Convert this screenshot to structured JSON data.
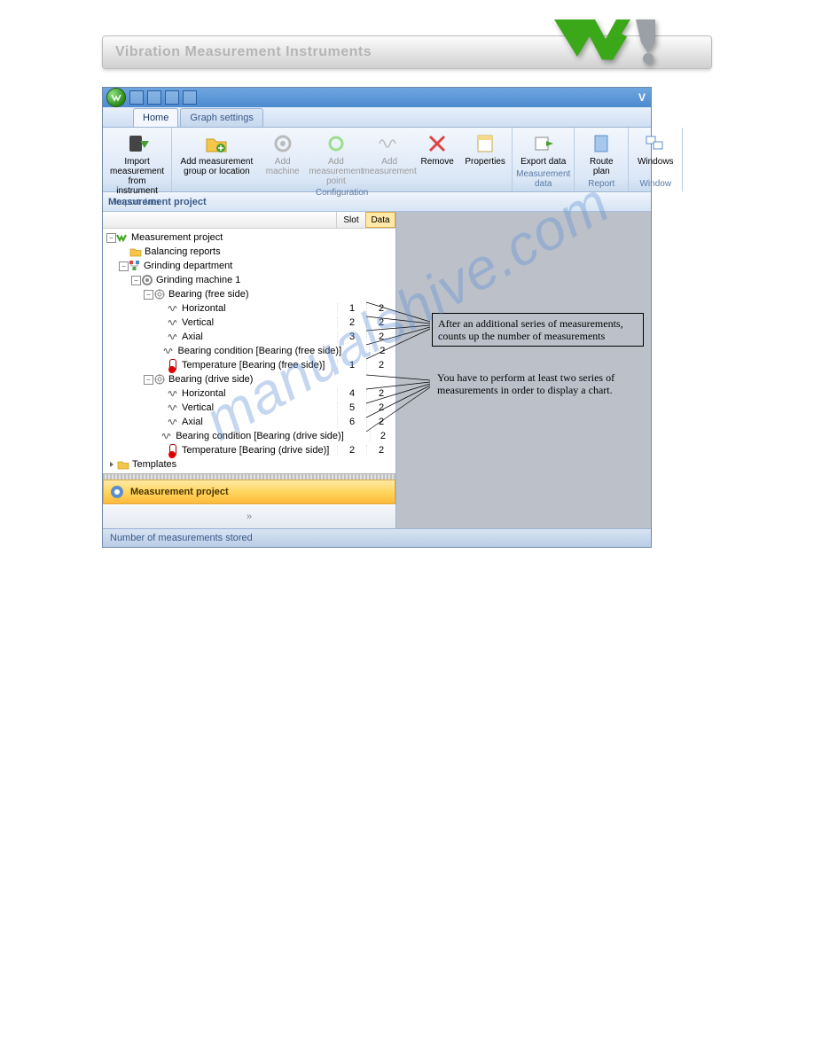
{
  "doc_header": {
    "title": "Vibration Measurement Instruments"
  },
  "titlebar": {
    "app_initial": "V"
  },
  "tabs": {
    "home": "Home",
    "graph": "Graph settings"
  },
  "ribbon": {
    "import_group": {
      "btn": "Import measurement\nfrom instrument",
      "title": "Import data"
    },
    "config_group": {
      "add_group": "Add measurement\ngroup or location",
      "add_machine": "Add\nmachine",
      "add_point": "Add measurement\npoint",
      "add_meas": "Add\nmeasurement",
      "remove": "Remove",
      "props": "Properties",
      "title": "Configuration"
    },
    "export_group": {
      "btn": "Export\ndata",
      "title": "Measurement data"
    },
    "report_group": {
      "btn": "Route\nplan",
      "title": "Report"
    },
    "window_group": {
      "btn": "Windows",
      "title": "Window"
    }
  },
  "panel_title": "Measurement project",
  "columns": {
    "slot": "Slot",
    "data": "Data"
  },
  "tree": {
    "root": "Measurement project",
    "balancing": "Balancing reports",
    "dept": "Grinding department",
    "machine": "Grinding machine 1",
    "bearing_free": "Bearing (free side)",
    "bearing_drive": "Bearing (drive side)",
    "templates": "Templates",
    "items_free": [
      {
        "label": "Horizontal",
        "slot": "1",
        "data": "2",
        "icon": "vib"
      },
      {
        "label": "Vertical",
        "slot": "2",
        "data": "2",
        "icon": "vib"
      },
      {
        "label": "Axial",
        "slot": "3",
        "data": "2",
        "icon": "vib"
      },
      {
        "label": "Bearing condition [Bearing (free side)]",
        "slot": "",
        "data": "2",
        "icon": "vib"
      },
      {
        "label": "Temperature [Bearing (free side)]",
        "slot": "1",
        "data": "2",
        "icon": "therm"
      }
    ],
    "items_drive": [
      {
        "label": "Horizontal",
        "slot": "4",
        "data": "2",
        "icon": "vib"
      },
      {
        "label": "Vertical",
        "slot": "5",
        "data": "2",
        "icon": "vib"
      },
      {
        "label": "Axial",
        "slot": "6",
        "data": "2",
        "icon": "vib"
      },
      {
        "label": "Bearing condition [Bearing (drive side)]",
        "slot": "",
        "data": "2",
        "icon": "vib"
      },
      {
        "label": "Temperature [Bearing (drive side)]",
        "slot": "2",
        "data": "2",
        "icon": "therm"
      }
    ]
  },
  "project_bar": "Measurement project",
  "statusbar": "Number of measurements stored",
  "annotation_box": "After an additional series of measurements, counts up the number of measurements",
  "annotation_text": "You have to perform at least two series of measurements in order to display a chart.",
  "watermark": "manualshive.com"
}
